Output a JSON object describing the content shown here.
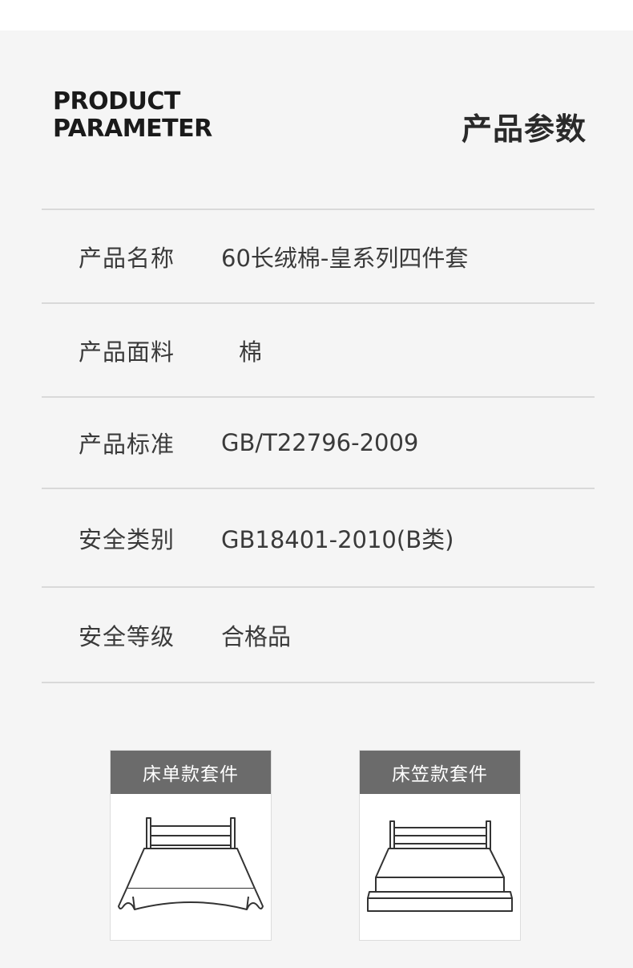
{
  "header": {
    "title_en_line1": "PRODUCT",
    "title_en_line2": "PARAMETER",
    "title_cn": "产品参数"
  },
  "params": [
    {
      "label": "产品名称",
      "value": "60长绒棉-皇系列四件套"
    },
    {
      "label": "产品面料",
      "value": "棉"
    },
    {
      "label": "产品标准",
      "value": "GB/T22796-2009"
    },
    {
      "label": "安全类别",
      "value": "GB18401-2010(B类)"
    },
    {
      "label": "安全等级",
      "value": "合格品"
    }
  ],
  "cards": [
    {
      "title": "床单款套件",
      "icon": "bed-sheet-icon"
    },
    {
      "title": "床笠款套件",
      "icon": "fitted-sheet-bed-icon"
    }
  ]
}
